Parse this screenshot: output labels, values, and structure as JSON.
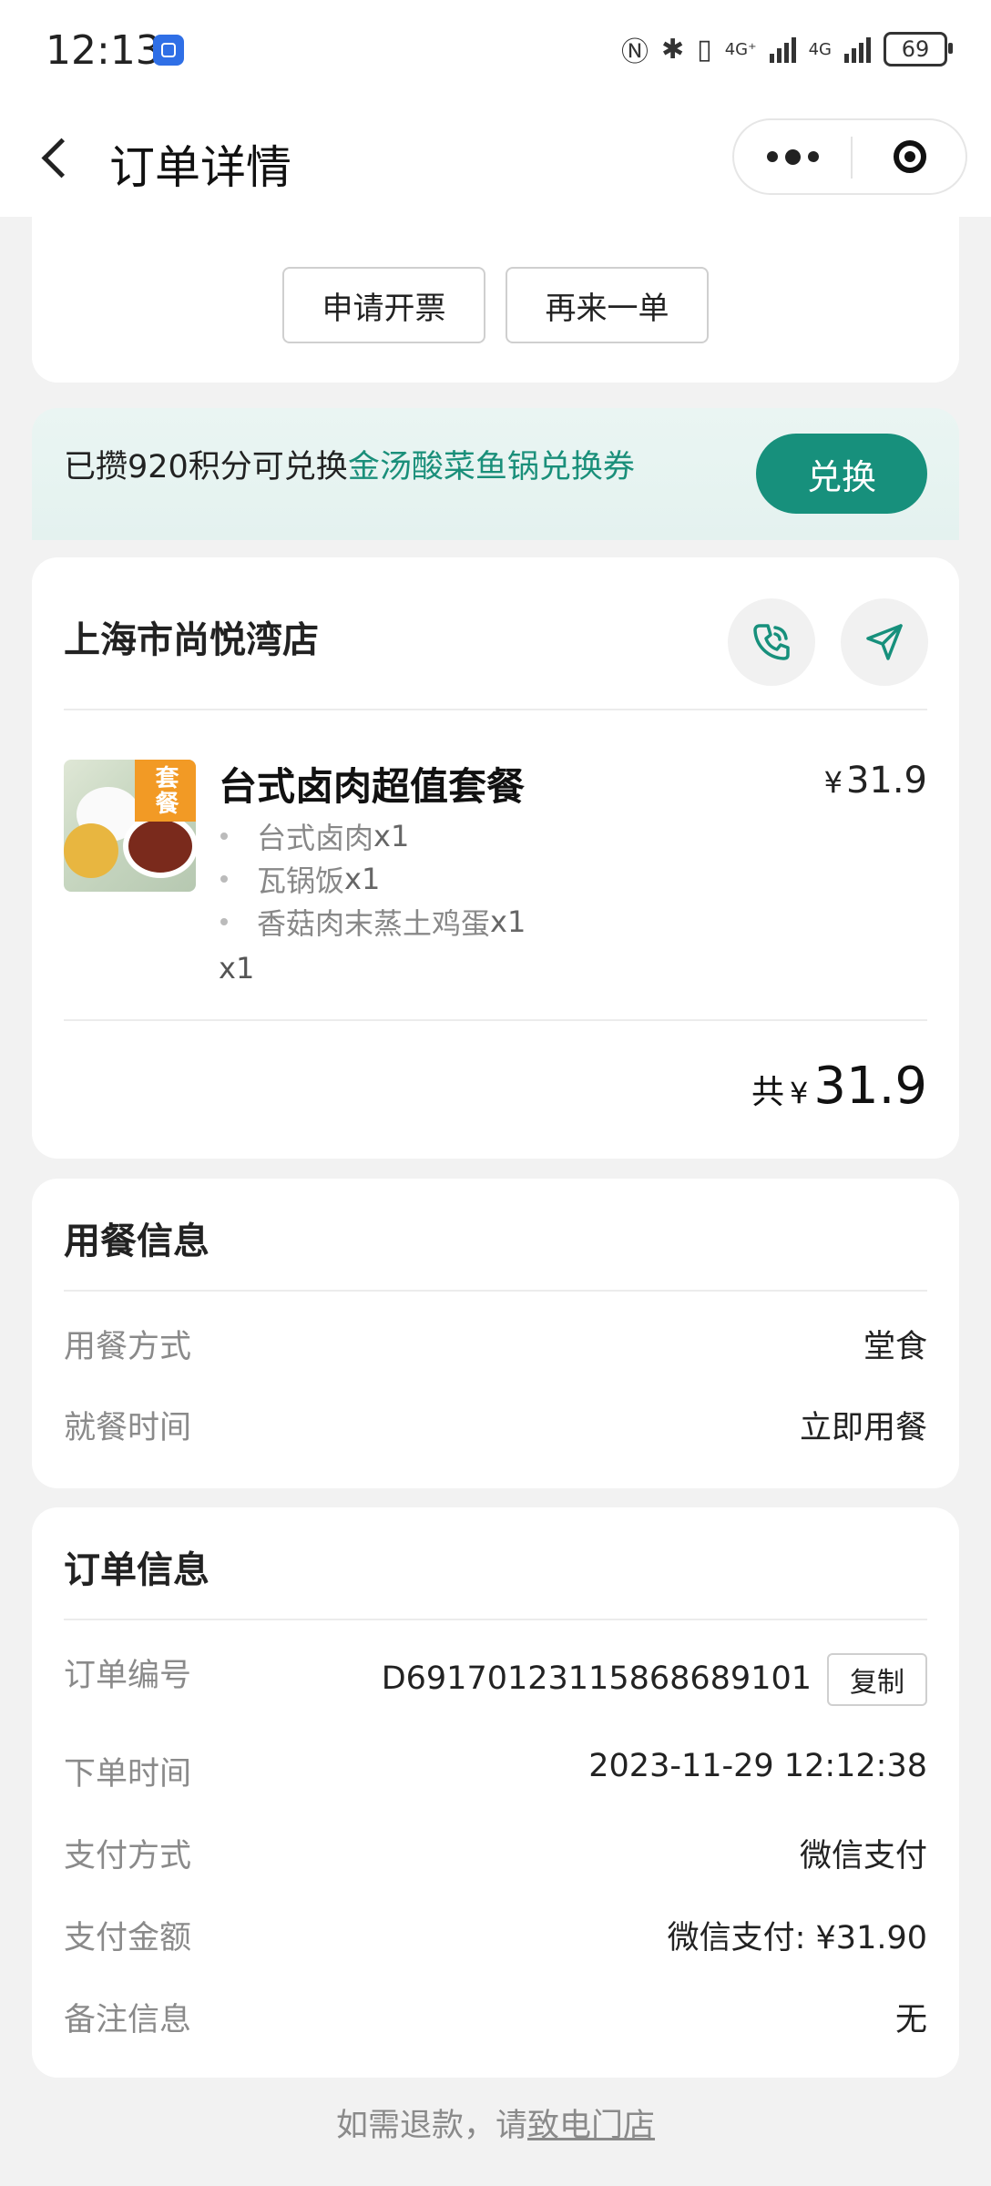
{
  "status_bar": {
    "time": "12:13",
    "battery": "69",
    "network_1": "4G⁺",
    "network_2": "4G"
  },
  "navbar": {
    "title": "订单详情"
  },
  "actions": {
    "invoice_label": "申请开票",
    "reorder_label": "再来一单"
  },
  "points_banner": {
    "prefix": "已攒920积分可兑换",
    "highlight": "金汤酸菜鱼锅兑换券",
    "button_label": "兑换"
  },
  "order": {
    "store_name": "上海市尚悦湾店",
    "item": {
      "name": "台式卤肉超值套餐",
      "price_symbol": "¥",
      "price": "31.9",
      "image_tag": "套餐",
      "components": [
        {
          "name": "台式卤肉",
          "qty": "x1"
        },
        {
          "name": "瓦锅饭",
          "qty": "x1"
        },
        {
          "name": "香菇肉末蒸土鸡蛋",
          "qty": "x1"
        }
      ],
      "quantity": "x1"
    },
    "total_label": "共",
    "total_symbol": "¥",
    "total_amount": "31.9"
  },
  "dining_info": {
    "title": "用餐信息",
    "rows": [
      {
        "label": "用餐方式",
        "value": "堂食"
      },
      {
        "label": "就餐时间",
        "value": "立即用餐"
      }
    ]
  },
  "order_info": {
    "title": "订单信息",
    "order_no_label": "订单编号",
    "order_no": "D6917012311586868 9101",
    "copy_label": "复制",
    "rows": [
      {
        "label": "下单时间",
        "value": "2023-11-29 12:12:38"
      },
      {
        "label": "支付方式",
        "value": "微信支付"
      },
      {
        "label": "支付金额",
        "value": "微信支付: ¥31.90"
      },
      {
        "label": "备注信息",
        "value": "无"
      }
    ]
  },
  "footer": {
    "refund_prefix": "如需退款，请",
    "refund_link": "致电门店"
  },
  "colors": {
    "accent": "#17907c",
    "highlight_text": "#1a8f7a",
    "background": "#f2f2f2",
    "banner_bg": "#e6f3f0"
  },
  "icons": [
    "back-arrow-icon",
    "more-dots-icon",
    "target-close-icon",
    "phone-icon",
    "navigate-arrow-icon"
  ]
}
